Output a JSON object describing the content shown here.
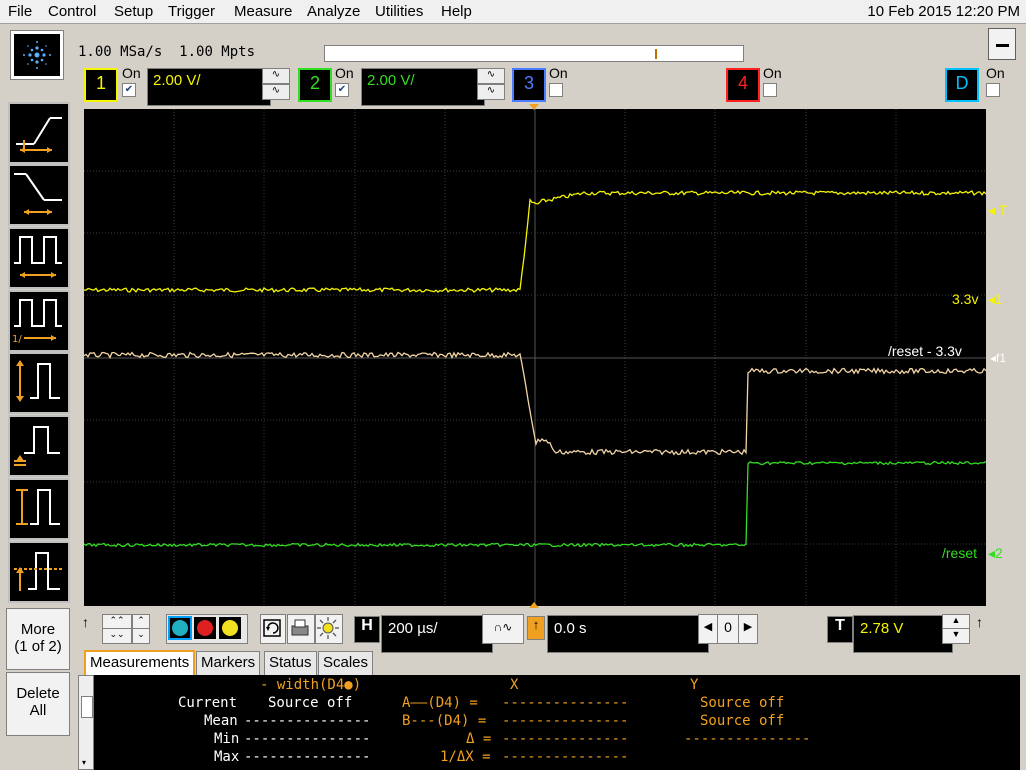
{
  "menu": [
    "File",
    "Control",
    "Setup",
    "Trigger",
    "Measure",
    "Analyze",
    "Utilities",
    "Help"
  ],
  "datetime": "10 Feb 2015 12:20 PM",
  "acquisition": {
    "sample_rate": "1.00 MSa/s",
    "memory_depth": "1.00 Mpts"
  },
  "channels": [
    {
      "number": "1",
      "on_label": "On",
      "checked": true,
      "scale": "2.00 V/",
      "color": "#f5f500"
    },
    {
      "number": "2",
      "on_label": "On",
      "checked": true,
      "scale": "2.00 V/",
      "color": "#33dd22"
    },
    {
      "number": "3",
      "on_label": "On",
      "checked": false,
      "color": "#4a7cff"
    },
    {
      "number": "4",
      "on_label": "On",
      "checked": false,
      "color": "#ff2020"
    },
    {
      "number": "D",
      "on_label": "On",
      "checked": false,
      "color": "#00c0ff"
    }
  ],
  "side_buttons": {
    "more_line1": "More",
    "more_line2": "(1 of 2)",
    "delete_line1": "Delete",
    "delete_line2": "All"
  },
  "trace_labels": {
    "trigger_marker": "T",
    "ch1": "3.3v",
    "ch1_marker": "1",
    "f1": "/reset - 3.3v",
    "f1_marker": "f1",
    "ch2": "/reset",
    "ch2_marker": "2"
  },
  "horizontal": {
    "label": "H",
    "timebase": "200 µs/",
    "position_index": "0",
    "delay": "0.0 s"
  },
  "trigger": {
    "label": "T",
    "level": "2.78 V"
  },
  "tabs": [
    "Measurements",
    "Markers",
    "Status",
    "Scales"
  ],
  "measurements": {
    "header_left": "- width(D4●)",
    "header_x": "X",
    "header_y": "Y",
    "rows": [
      {
        "label": "Current",
        "value": "Source off",
        "marker": "A——(D4) =",
        "x": "---------------",
        "y": "Source off"
      },
      {
        "label": "Mean",
        "value": "---------------",
        "marker": "B---(D4) =",
        "x": "---------------",
        "y": "Source off"
      },
      {
        "label": "Min",
        "value": "---------------",
        "marker": "Δ =",
        "x": "---------------",
        "y": "---------------"
      },
      {
        "label": "Max",
        "value": "---------------",
        "marker": "1/ΔX =",
        "x": "---------------",
        "y": ""
      }
    ]
  },
  "colors": {
    "accent": "#f0a020",
    "ch1": "#f5f500",
    "ch2": "#33dd22",
    "f1": "#f3d5a5"
  }
}
